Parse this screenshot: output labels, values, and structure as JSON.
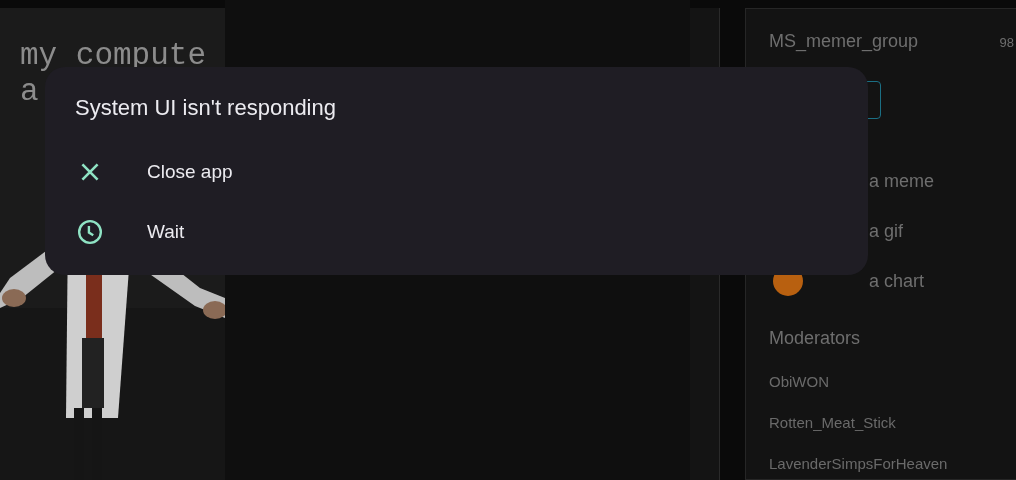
{
  "meme": {
    "kind": "picture",
    "caption_lines": [
      "my compute",
      "a"
    ]
  },
  "sidebar": {
    "group_name": "MS_memer_group",
    "count": "98",
    "links": [
      {
        "label": "a meme"
      },
      {
        "label": "a gif"
      },
      {
        "label": "a chart"
      }
    ],
    "moderators_heading": "Moderators",
    "moderators": [
      "ObiWON",
      "Rotten_Meat_Stick",
      "LavenderSimpsForHeaven"
    ]
  },
  "dialog": {
    "title": "System UI isn't responding",
    "actions": [
      {
        "kind": "close",
        "label": "Close app"
      },
      {
        "kind": "wait",
        "label": "Wait"
      }
    ]
  }
}
